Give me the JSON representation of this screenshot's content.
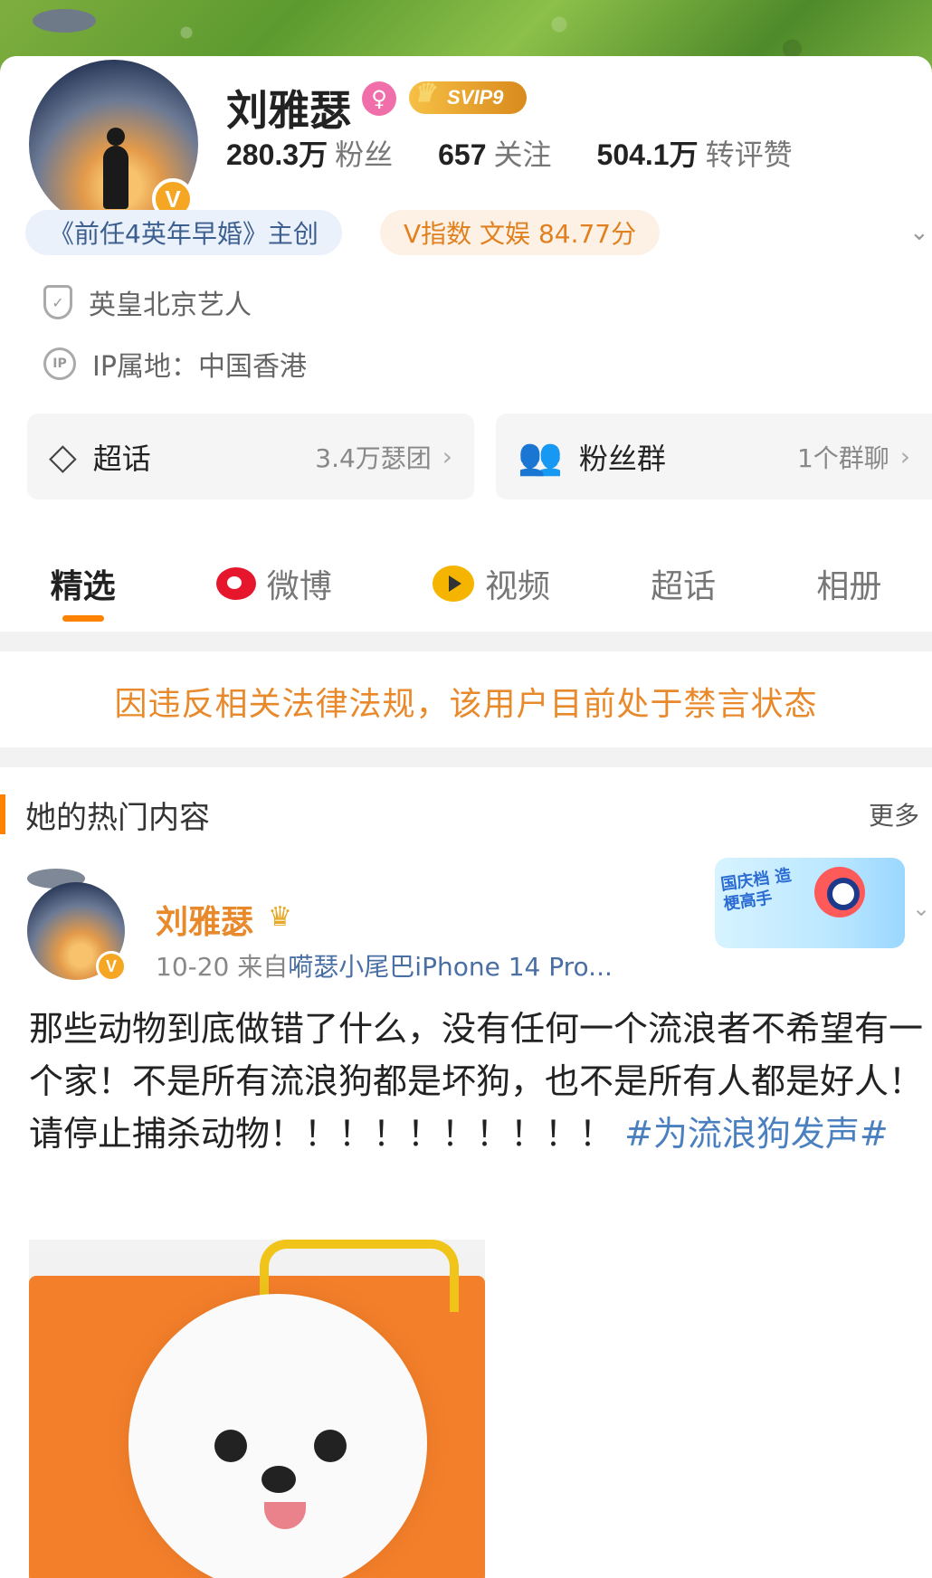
{
  "profile": {
    "name": "刘雅瑟",
    "svip_label": "SVIP9",
    "verified_mark": "V",
    "stats": [
      {
        "value": "280.3万",
        "label": "粉丝"
      },
      {
        "value": "657",
        "label": "关注"
      },
      {
        "value": "504.1万",
        "label": "转评赞"
      }
    ],
    "tag_work": "《前任4英年早婚》主创",
    "tag_vindex": "V指数 文娱 84.77分",
    "company": "英皇北京艺人",
    "ip_location": "IP属地：中国香港",
    "ip_icon_text": "IP"
  },
  "features": [
    {
      "label": "超话",
      "meta": "3.4万瑟团",
      "icon": "diamond-icon"
    },
    {
      "label": "粉丝群",
      "meta": "1个群聊",
      "icon": "group-icon"
    }
  ],
  "tabs": [
    {
      "label": "精选",
      "active": true
    },
    {
      "label": "微博",
      "active": false
    },
    {
      "label": "视频",
      "active": false
    },
    {
      "label": "超话",
      "active": false
    },
    {
      "label": "相册",
      "active": false
    }
  ],
  "notice": "因违反相关法律法规，该用户目前处于禁言状态",
  "hot_section": {
    "title": "她的热门内容",
    "more": "更多"
  },
  "post": {
    "author": "刘雅瑟",
    "date": "10-20",
    "source_prefix": "来自",
    "source": "嗬瑟小尾巴iPhone 14 Pro...",
    "text": "那些动物到底做错了什么，没有任何一个流浪者不希望有一个家！不是所有流浪狗都是坏狗，也不是所有人都是好人！请停止捕杀动物！！！！！！！！！！ ",
    "hashtag": "#为流浪狗发声#",
    "promo_text": "国庆档 造梗高手"
  },
  "colors": {
    "accent": "#ff8200",
    "notice": "#e8892b",
    "link": "#4a7fc0"
  }
}
